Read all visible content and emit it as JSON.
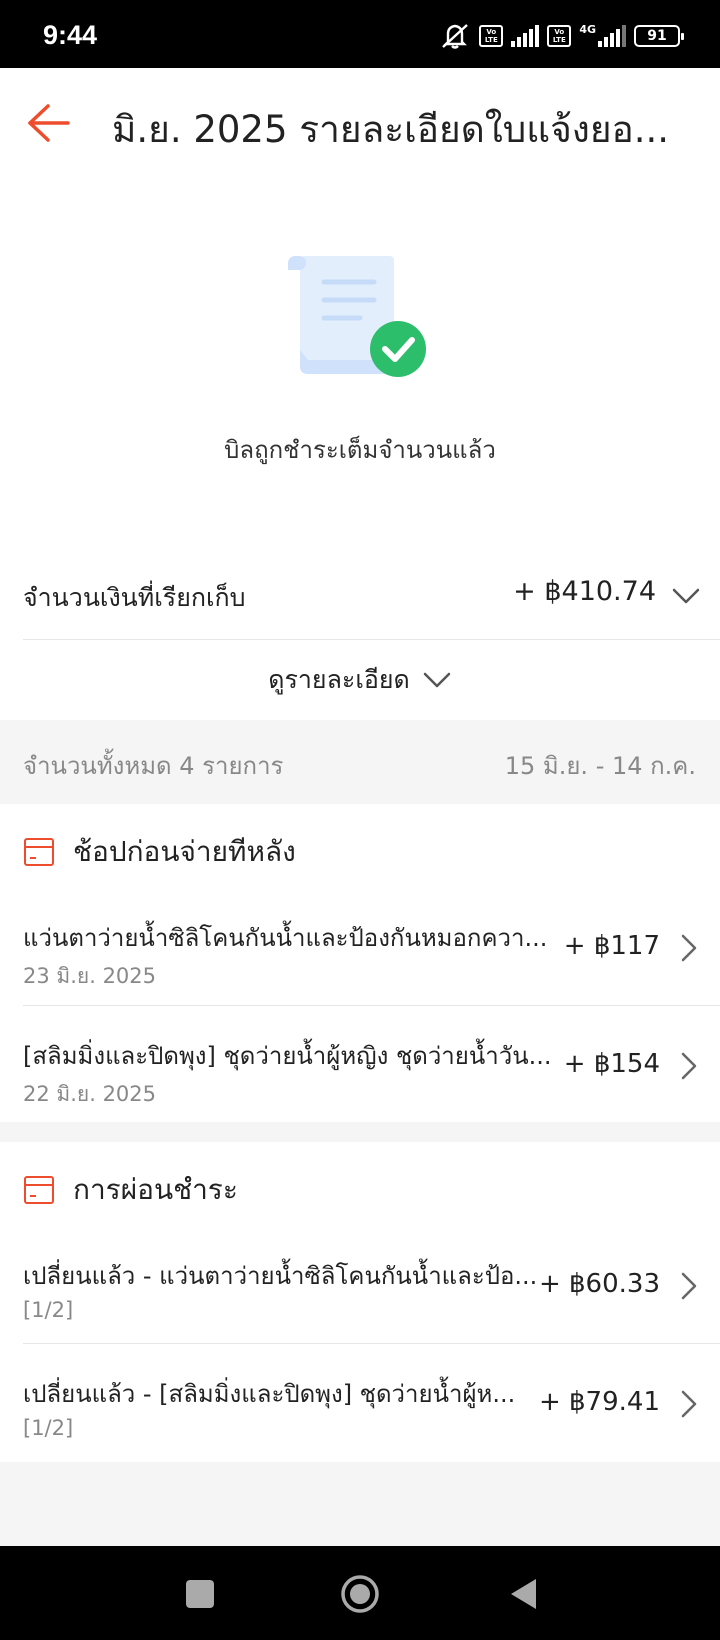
{
  "status_bar": {
    "time": "9:44",
    "battery": "91",
    "network": "4G",
    "volte_label": "Vo LTE",
    "icons": [
      "mute-icon",
      "volte-icon",
      "signal-icon",
      "volte-icon",
      "signal-4g-icon",
      "battery-icon"
    ]
  },
  "header": {
    "title": "มิ.ย. 2025 รายละเอียดใบแจ้งยอ...",
    "back_icon": "back-arrow-icon"
  },
  "status": {
    "message": "บิลถูกชำระเต็มจำนวนแล้ว",
    "icon": "paid-receipt-icon"
  },
  "amount": {
    "label": "จำนวนเงินที่เรียกเก็บ",
    "value": "+ ฿410.74"
  },
  "details_toggle": {
    "label": "ดูรายละเอียด"
  },
  "summary": {
    "count": "จำนวนทั้งหมด 4 รายการ",
    "period": "15 มิ.ย. - 14 ก.ค."
  },
  "sections": [
    {
      "title": "ช้อปก่อนจ่ายทีหลัง",
      "items": [
        {
          "title": "แว่นตาว่ายน้ำซิลิโคนกันน้ำและป้องกันหมอกควา...",
          "subtitle": "23 มิ.ย. 2025",
          "amount": "+ ฿117"
        },
        {
          "title": "[สลิมมิ่งและปิดพุง] ชุดว่ายน้ำผู้หญิง ชุดว่ายน้ำวัน...",
          "subtitle": "22 มิ.ย. 2025",
          "amount": "+ ฿154"
        }
      ]
    },
    {
      "title": "การผ่อนชำระ",
      "items": [
        {
          "title": "เปลี่ยนแล้ว - แว่นตาว่ายน้ำซิลิโคนกันน้ำและป้อ...",
          "subtitle": "[1/2]",
          "amount": "+ ฿60.33"
        },
        {
          "title": "เปลี่ยนแล้ว - [สลิมมิ่งและปิดพุง] ชุดว่ายน้ำผู้ห...",
          "subtitle": "[1/2]",
          "amount": "+ ฿79.41"
        }
      ]
    }
  ],
  "colors": {
    "accent": "#ee4d2d",
    "success": "#2dbe6c",
    "muted_text": "#888888",
    "band": "#f5f5f5"
  }
}
